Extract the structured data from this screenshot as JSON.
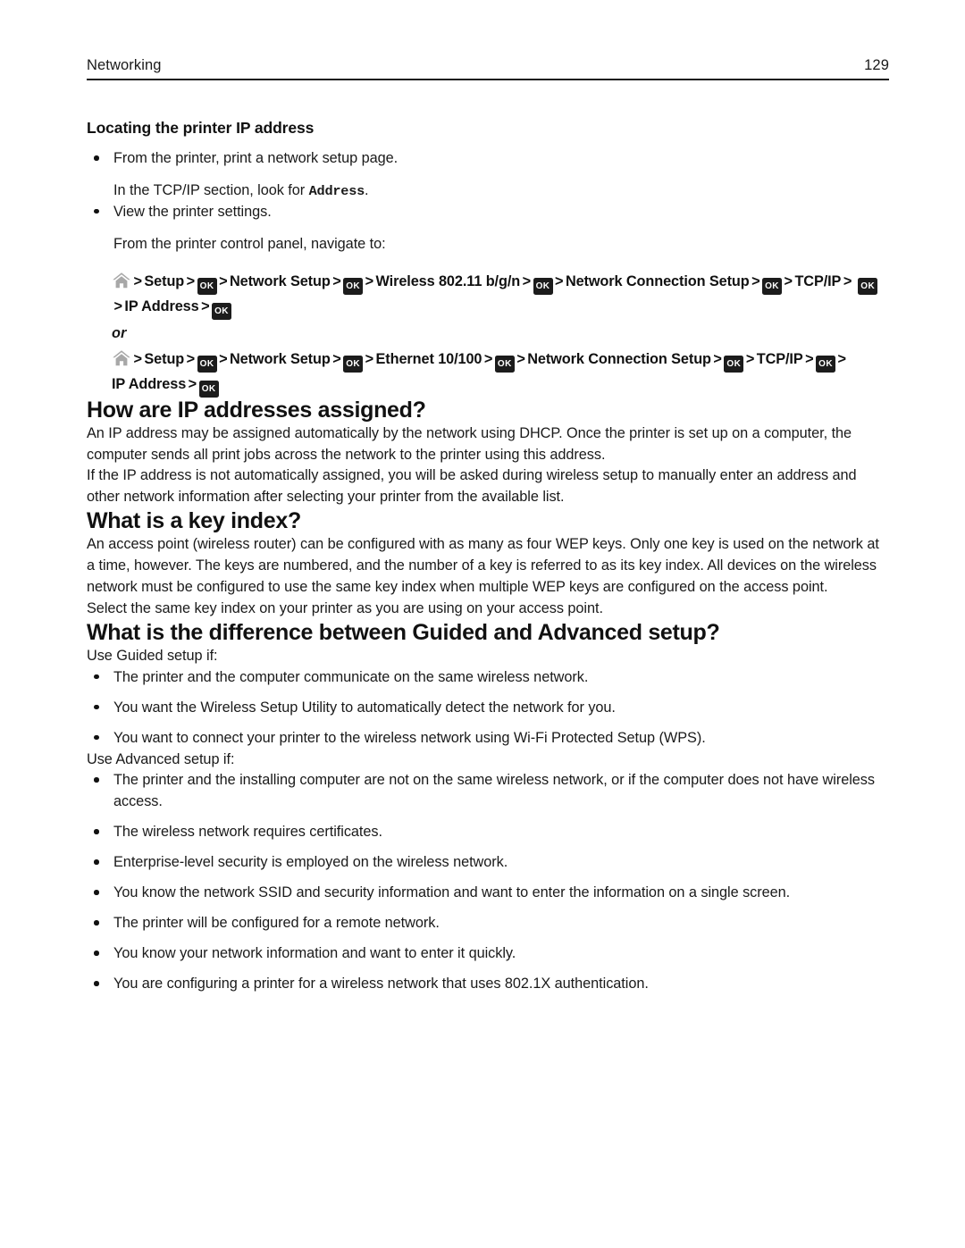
{
  "header": {
    "title": "Networking",
    "page_number": "129"
  },
  "sections": {
    "locating": {
      "heading": "Locating the printer IP address",
      "bullet_1": "From the printer, print a network setup page.",
      "bullet_1_sub_prefix": "In the TCP/IP section, look for ",
      "bullet_1_sub_mono": "Address",
      "bullet_1_sub_suffix": ".",
      "bullet_2": "View the printer settings.",
      "bullet_2_sub": "From the printer control panel, navigate to:",
      "or_label": "or",
      "nav_path_wireless": {
        "icon": "home-icon",
        "steps": [
          "Setup",
          "ok-key",
          "Network Setup",
          "ok-key",
          "Wireless 802.11 b/g/n",
          "ok-key",
          "Network Connection Setup",
          "ok-key",
          "TCP/IP",
          "ok-key",
          "IP Address",
          "ok-key"
        ],
        "separator": ">"
      },
      "nav_path_ethernet": {
        "icon": "home-icon",
        "steps": [
          "Setup",
          "ok-key",
          "Network Setup",
          "ok-key",
          "Ethernet 10/100",
          "ok-key",
          "Network Connection Setup",
          "ok-key",
          "TCP/IP",
          "ok-key",
          "IP Address",
          "ok-key"
        ],
        "separator": ">"
      },
      "ok_key_label": "OK"
    },
    "how_assigned": {
      "heading": "How are IP addresses assigned?",
      "para_1": "An IP address may be assigned automatically by the network using DHCP. Once the printer is set up on a computer, the computer sends all print jobs across the network to the printer using this address.",
      "para_2": "If the IP address is not automatically assigned, you will be asked during wireless setup to manually enter an address and other network information after selecting your printer from the available list."
    },
    "key_index": {
      "heading": "What is a key index?",
      "para_1": "An access point (wireless router) can be configured with as many as four WEP keys. Only one key is used on the network at a time, however. The keys are numbered, and the number of a key is referred to as its key index. All devices on the wireless network must be configured to use the same key index when multiple WEP keys are configured on the access point.",
      "para_2": "Select the same key index on your printer as you are using on your access point."
    },
    "guided_vs_advanced": {
      "heading": "What is the difference between Guided and Advanced setup?",
      "guided_intro": "Use Guided setup if:",
      "guided_bullets": [
        "The printer and the computer communicate on the same wireless network.",
        "You want the Wireless Setup Utility to automatically detect the network for you.",
        "You want to connect your printer to the wireless network using Wi-Fi Protected Setup (WPS)."
      ],
      "advanced_intro": "Use Advanced setup if:",
      "advanced_bullets": [
        "The printer and the installing computer are not on the same wireless network, or if the computer does not have wireless access.",
        "The wireless network requires certificates.",
        "Enterprise-level security is employed on the wireless network.",
        "You know the network SSID and security information and want to enter the information on a single screen.",
        "The printer will be configured for a remote network.",
        "You know your network information and want to enter it quickly.",
        "You are configuring a printer for a wireless network that uses 802.1X authentication."
      ]
    }
  },
  "colors": {
    "text": "#1a1a1a",
    "key_background": "#1c1c1c",
    "key_text": "#ffffff",
    "home_icon": "#a6a6a6",
    "rule": "#1a1a1a"
  }
}
